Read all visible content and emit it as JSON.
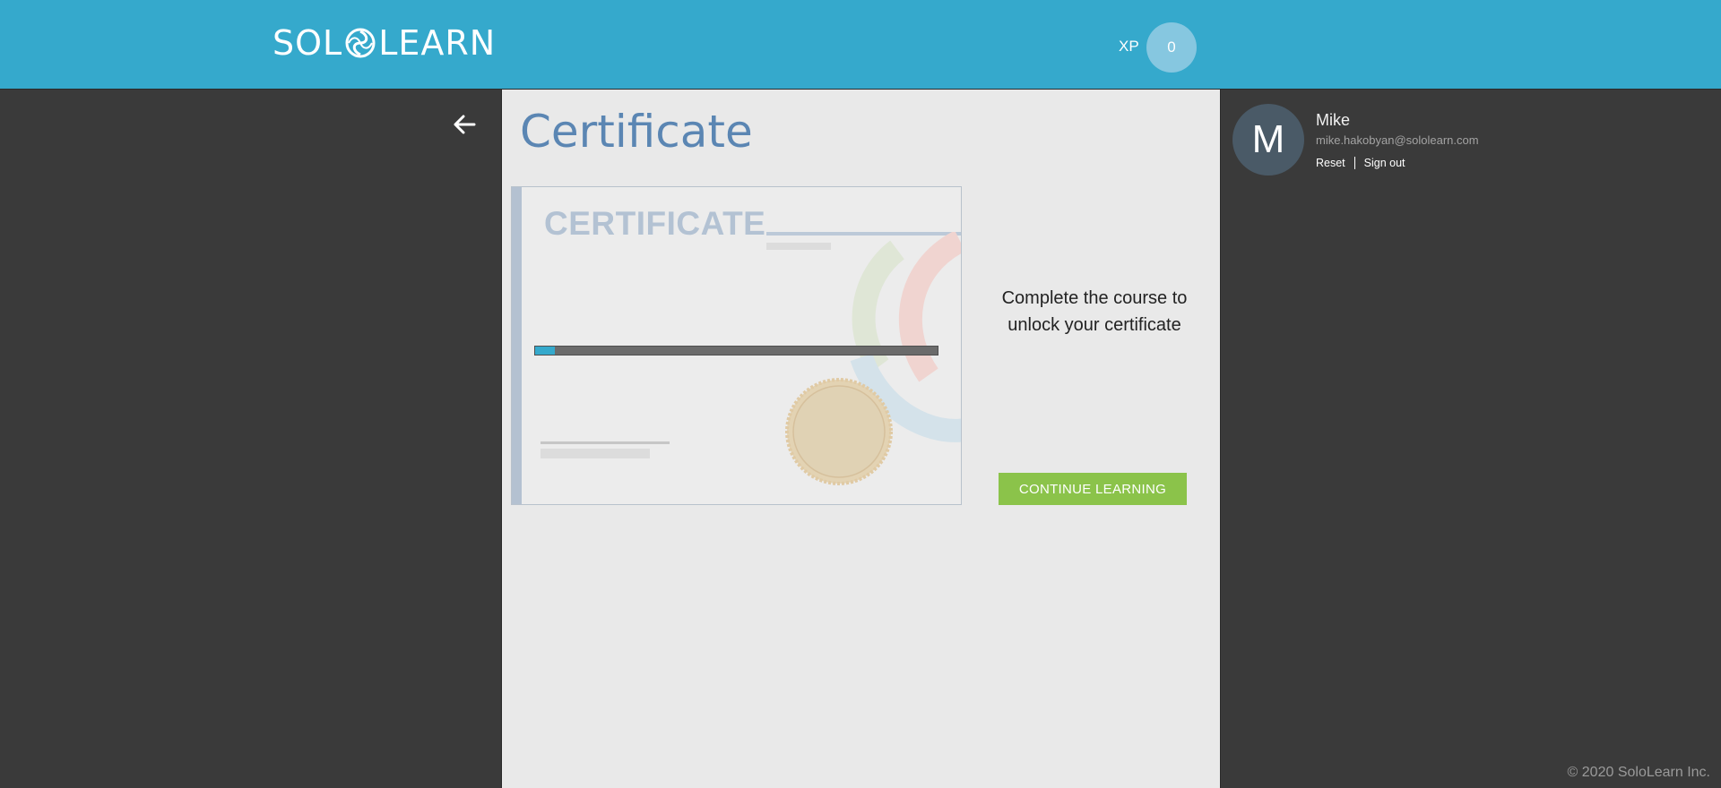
{
  "header": {
    "logo_left": "SOL",
    "logo_right": "LEARN",
    "xp_label": "XP",
    "xp_value": "0"
  },
  "main": {
    "title": "Certificate",
    "certificate": {
      "heading": "CERTIFICATE",
      "progress_fraction": 0.05
    },
    "unlock_message": "Complete the course to unlock your certificate",
    "continue_button": "CONTINUE LEARNING"
  },
  "profile": {
    "avatar_letter": "M",
    "name": "Mike",
    "email": "mike.hakobyan@sololearn.com",
    "reset_label": "Reset",
    "signout_label": "Sign out"
  },
  "footer": {
    "copyright": "© 2020 SoloLearn Inc."
  },
  "colors": {
    "header": "#35a9cc",
    "sidebar": "#3a3a3a",
    "main": "#e9e9e9",
    "title": "#5b86b3",
    "button": "#8bc34a"
  },
  "icons": {
    "back": "arrow-left-icon",
    "logo": "sololearn-swirl-icon"
  }
}
